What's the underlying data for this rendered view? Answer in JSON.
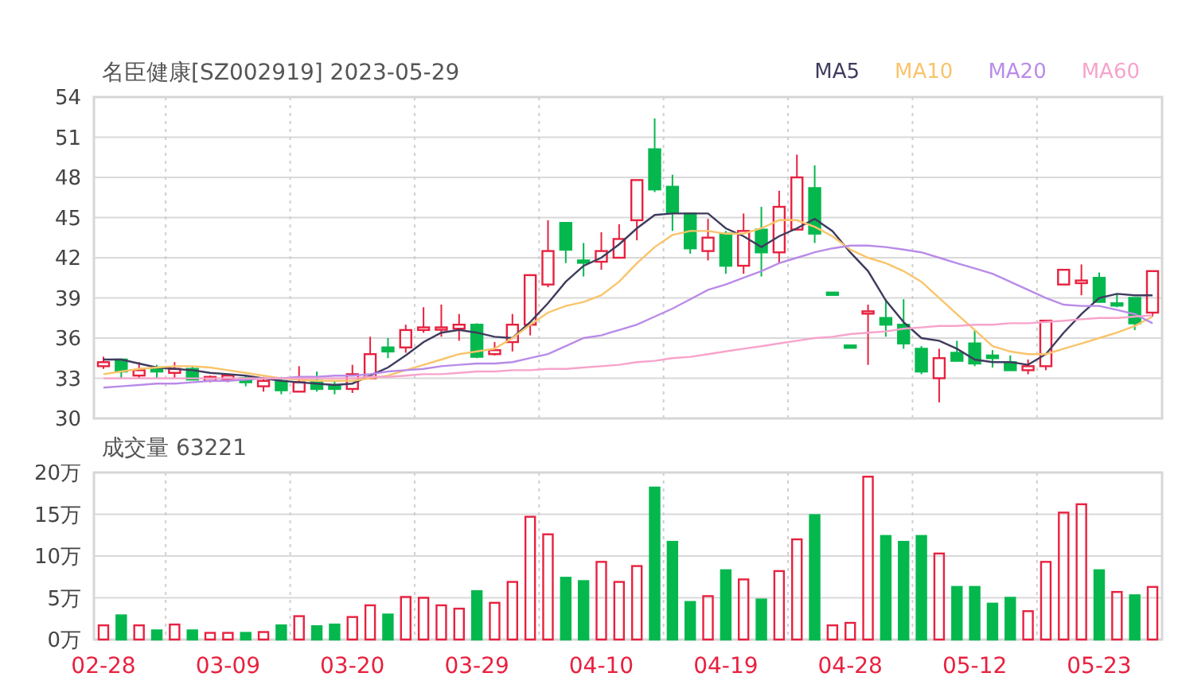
{
  "price_chart": {
    "chart_data": {
      "type": "candlestick",
      "title": "名臣健康[SZ002919] 2023-05-29",
      "grid": true,
      "ylim": [
        30,
        54
      ],
      "yticks": [
        30,
        33,
        36,
        39,
        42,
        45,
        48,
        51,
        54
      ],
      "ohlc": [
        [
          33.9,
          34.6,
          33.7,
          34.2
        ],
        [
          34.4,
          34.4,
          33.0,
          33.5
        ],
        [
          33.2,
          34.2,
          33.0,
          33.6
        ],
        [
          33.8,
          34.0,
          33.0,
          33.5
        ],
        [
          33.4,
          34.2,
          33.0,
          33.7
        ],
        [
          33.7,
          33.9,
          32.9,
          32.9
        ],
        [
          32.8,
          33.2,
          32.7,
          33.1
        ],
        [
          32.9,
          33.3,
          32.7,
          33.2
        ],
        [
          33.0,
          33.2,
          32.4,
          32.7
        ],
        [
          32.4,
          33.1,
          32.0,
          32.8
        ],
        [
          32.8,
          33.1,
          31.8,
          32.1
        ],
        [
          32.0,
          33.9,
          32.0,
          32.7
        ],
        [
          32.8,
          33.5,
          32.0,
          32.2
        ],
        [
          32.5,
          32.8,
          31.8,
          32.2
        ],
        [
          32.2,
          34.0,
          31.9,
          33.3
        ],
        [
          33.0,
          36.1,
          32.9,
          34.8
        ],
        [
          35.3,
          36.0,
          34.5,
          35.0
        ],
        [
          35.3,
          37.0,
          34.9,
          36.6
        ],
        [
          36.6,
          38.3,
          36.4,
          36.8
        ],
        [
          36.7,
          38.5,
          36.1,
          36.8
        ],
        [
          36.7,
          37.8,
          35.8,
          37.0
        ],
        [
          37.0,
          37.1,
          34.5,
          34.6
        ],
        [
          34.8,
          35.7,
          34.7,
          35.1
        ],
        [
          35.7,
          37.8,
          35.0,
          37.0
        ],
        [
          37.0,
          40.7,
          36.2,
          40.7
        ],
        [
          40.0,
          44.8,
          39.8,
          42.5
        ],
        [
          44.6,
          44.6,
          41.6,
          42.6
        ],
        [
          41.8,
          43.1,
          40.6,
          41.7
        ],
        [
          41.7,
          43.9,
          41.1,
          42.5
        ],
        [
          42.0,
          44.5,
          42.0,
          43.4
        ],
        [
          44.8,
          47.8,
          43.3,
          47.8
        ],
        [
          50.1,
          52.4,
          46.9,
          47.1
        ],
        [
          47.3,
          48.2,
          44.0,
          45.4
        ],
        [
          45.3,
          45.3,
          42.3,
          42.7
        ],
        [
          42.5,
          44.9,
          41.8,
          43.5
        ],
        [
          43.8,
          44.0,
          40.8,
          41.4
        ],
        [
          41.4,
          45.3,
          40.8,
          44.0
        ],
        [
          44.1,
          45.8,
          40.6,
          42.4
        ],
        [
          42.4,
          47.0,
          41.6,
          45.8
        ],
        [
          44.1,
          49.7,
          44.1,
          48.0
        ],
        [
          47.2,
          48.9,
          43.1,
          43.8
        ],
        [
          39.4,
          39.4,
          39.35,
          39.35
        ],
        [
          35.45,
          35.45,
          35.4,
          35.4
        ],
        [
          37.9,
          38.5,
          34.0,
          38.0
        ],
        [
          37.5,
          38.9,
          36.1,
          37.0
        ],
        [
          37.0,
          38.9,
          35.2,
          35.6
        ],
        [
          35.2,
          35.4,
          33.3,
          33.5
        ],
        [
          33.0,
          35.2,
          31.2,
          34.5
        ],
        [
          34.9,
          35.8,
          34.3,
          34.3
        ],
        [
          35.6,
          36.6,
          33.9,
          34.1
        ],
        [
          34.7,
          35.1,
          33.8,
          34.5
        ],
        [
          34.2,
          34.7,
          33.6,
          33.6
        ],
        [
          33.6,
          34.4,
          33.3,
          33.9
        ],
        [
          33.9,
          37.3,
          33.6,
          37.3
        ],
        [
          40.0,
          41.1,
          40.0,
          41.1
        ],
        [
          40.1,
          41.5,
          39.2,
          40.3
        ],
        [
          40.5,
          40.9,
          38.7,
          38.7
        ],
        [
          38.6,
          39.3,
          38.3,
          38.5
        ],
        [
          39.0,
          39.0,
          36.6,
          37.1
        ],
        [
          37.9,
          41.0,
          37.6,
          41.0
        ]
      ]
    }
  },
  "moving_averages": {
    "chart_data": {
      "type": "line",
      "ylim": [
        30,
        54
      ],
      "series": [
        {
          "name": "MA5",
          "color": "#3f3b5e",
          "values": [
            34.4,
            34.4,
            34.1,
            33.8,
            33.7,
            33.6,
            33.4,
            33.3,
            33.2,
            33.0,
            32.8,
            32.7,
            32.6,
            32.5,
            32.6,
            33.2,
            33.8,
            34.7,
            35.7,
            36.4,
            36.6,
            36.4,
            36.1,
            36.0,
            37.2,
            38.6,
            40.2,
            41.4,
            42.0,
            43.0,
            44.2,
            45.2,
            45.3,
            45.3,
            45.3,
            44.2,
            43.6,
            42.8,
            43.6,
            44.2,
            44.9,
            44.0,
            42.4,
            41.0,
            38.8,
            37.2,
            36.0,
            35.8,
            35.2,
            34.4,
            34.2,
            34.2,
            34.0,
            34.8,
            36.4,
            37.8,
            39.0,
            39.3,
            39.2,
            39.2
          ]
        },
        {
          "name": "MA10",
          "color": "#f9c46b",
          "values": [
            33.3,
            33.5,
            33.7,
            33.8,
            33.9,
            33.9,
            33.8,
            33.6,
            33.4,
            33.2,
            33.0,
            32.9,
            32.8,
            32.8,
            32.8,
            33.0,
            33.2,
            33.6,
            34.0,
            34.4,
            34.8,
            35.0,
            35.2,
            36.0,
            37.0,
            37.9,
            38.4,
            38.7,
            39.2,
            40.2,
            41.6,
            42.8,
            43.7,
            44.0,
            44.0,
            43.8,
            43.8,
            44.2,
            44.8,
            44.8,
            44.3,
            43.6,
            42.6,
            42.0,
            41.6,
            41.0,
            40.2,
            39.0,
            37.8,
            36.6,
            35.4,
            35.0,
            34.8,
            34.8,
            35.2,
            35.6,
            36.0,
            36.4,
            36.9,
            37.6
          ]
        },
        {
          "name": "MA20",
          "color": "#b98be8",
          "values": [
            32.3,
            32.4,
            32.5,
            32.6,
            32.6,
            32.7,
            32.8,
            32.8,
            32.9,
            33.0,
            33.0,
            33.1,
            33.1,
            33.2,
            33.2,
            33.3,
            33.5,
            33.6,
            33.7,
            33.9,
            34.0,
            34.1,
            34.1,
            34.2,
            34.5,
            34.8,
            35.4,
            36.0,
            36.2,
            36.6,
            37.0,
            37.6,
            38.2,
            38.9,
            39.6,
            40.0,
            40.5,
            41.0,
            41.6,
            42.0,
            42.4,
            42.7,
            42.9,
            42.9,
            42.8,
            42.6,
            42.4,
            42.0,
            41.6,
            41.2,
            40.8,
            40.2,
            39.6,
            39.0,
            38.5,
            38.4,
            38.4,
            38.1,
            37.8,
            37.1
          ]
        },
        {
          "name": "MA60",
          "color": "#f7a3cb",
          "values": [
            33.0,
            33.0,
            33.0,
            33.0,
            33.0,
            33.0,
            33.0,
            33.0,
            33.0,
            33.0,
            33.0,
            33.0,
            33.0,
            33.0,
            33.0,
            33.1,
            33.1,
            33.2,
            33.3,
            33.3,
            33.4,
            33.5,
            33.5,
            33.6,
            33.6,
            33.7,
            33.7,
            33.8,
            33.9,
            34.0,
            34.2,
            34.3,
            34.5,
            34.6,
            34.8,
            35.0,
            35.2,
            35.4,
            35.6,
            35.8,
            36.0,
            36.1,
            36.3,
            36.4,
            36.5,
            36.7,
            36.8,
            36.9,
            36.9,
            37.0,
            37.0,
            37.1,
            37.1,
            37.2,
            37.3,
            37.4,
            37.5,
            37.5,
            37.6,
            37.7
          ]
        }
      ]
    }
  },
  "volume_chart": {
    "chart_data": {
      "type": "bar",
      "title": "成交量 63221",
      "grid": true,
      "ylim": [
        0,
        20
      ],
      "stacked": true,
      "categories": [
        "02-28",
        null,
        null,
        null,
        null,
        null,
        null,
        "03-09",
        null,
        null,
        null,
        null,
        null,
        null,
        "03-20",
        null,
        null,
        null,
        null,
        null,
        null,
        "03-29",
        null,
        null,
        null,
        null,
        null,
        null,
        "04-10",
        null,
        null,
        null,
        null,
        null,
        null,
        "04-19",
        null,
        null,
        null,
        null,
        null,
        null,
        "04-28",
        null,
        null,
        null,
        null,
        null,
        null,
        "05-12",
        null,
        null,
        null,
        null,
        null,
        null,
        "05-23",
        null,
        null,
        null
      ],
      "yticks": [
        {
          "value": 0,
          "label": "0万"
        },
        {
          "value": 5,
          "label": "5万"
        },
        {
          "value": 10,
          "label": "10万"
        },
        {
          "value": 15,
          "label": "15万"
        },
        {
          "value": 20,
          "label": "20万"
        }
      ],
      "series": [
        {
          "color": "#e8213f",
          "values": [
            1.7,
            null,
            1.7,
            null,
            1.8,
            null,
            0.8,
            0.8,
            null,
            0.9,
            null,
            2.8,
            null,
            null,
            2.7,
            4.1,
            null,
            5.1,
            5.0,
            4.1,
            3.7,
            null,
            4.4,
            6.9,
            14.7,
            12.6,
            null,
            null,
            9.3,
            6.9,
            8.8,
            null,
            null,
            null,
            5.2,
            null,
            7.2,
            null,
            8.2,
            12.0,
            null,
            1.7,
            2.0,
            19.5,
            null,
            null,
            null,
            10.3,
            null,
            null,
            null,
            null,
            3.4,
            9.3,
            15.2,
            16.2,
            null,
            5.7,
            null,
            6.3
          ]
        },
        {
          "color": "#05b84e",
          "values": [
            null,
            2.9,
            null,
            1.1,
            null,
            1.1,
            null,
            null,
            0.8,
            null,
            1.7,
            null,
            1.6,
            1.8,
            null,
            null,
            3.0,
            null,
            null,
            null,
            null,
            5.8,
            null,
            null,
            null,
            null,
            7.4,
            7.0,
            null,
            null,
            null,
            18.2,
            11.7,
            4.5,
            null,
            8.3,
            null,
            4.8,
            null,
            null,
            14.9,
            null,
            null,
            null,
            12.4,
            11.7,
            12.4,
            null,
            6.3,
            6.3,
            4.3,
            5.0,
            null,
            null,
            null,
            null,
            8.3,
            null,
            5.3,
            null
          ]
        }
      ]
    }
  }
}
